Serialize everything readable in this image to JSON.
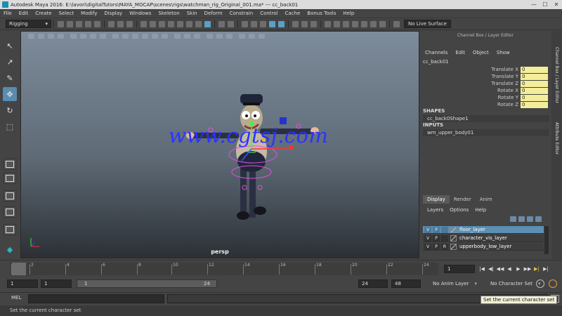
{
  "window": {
    "title": "Autodesk Maya 2016: E:\\lavori\\digitalTutors\\MAYA_MOCAP\\scenes\\rigs\\watchman_rig_Original_001.ma*   ---   cc_back01",
    "minimize": "—",
    "maximize": "☐",
    "close": "✕"
  },
  "menubar": [
    "File",
    "Edit",
    "Create",
    "Select",
    "Modify",
    "Display",
    "Windows",
    "Skeleton",
    "Skin",
    "Deform",
    "Constrain",
    "Control",
    "Cache",
    "Bonus Tools",
    "Help"
  ],
  "statusline": {
    "mode": "Rigging",
    "live_surface": "No Live Surface"
  },
  "viewport": {
    "camera_label": "persp",
    "watermark": "www.cgtsj.com"
  },
  "channel_box": {
    "header": "Channel Box / Layer Editor",
    "menu": [
      "Channels",
      "Edit",
      "Object",
      "Show"
    ],
    "node": "cc_back01",
    "attributes": [
      {
        "label": "Translate X",
        "value": "0"
      },
      {
        "label": "Translate Y",
        "value": "0"
      },
      {
        "label": "Translate Z",
        "value": "0"
      },
      {
        "label": "Rotate X",
        "value": "0"
      },
      {
        "label": "Rotate Y",
        "value": "0"
      },
      {
        "label": "Rotate Z",
        "value": "0"
      }
    ],
    "shapes_label": "SHAPES",
    "shape": "cc_back0Shape1",
    "inputs_label": "INPUTS",
    "input": "wm_upper_body01"
  },
  "side_tabs": [
    "Channel Box / Layer Editor",
    "Attribute Editor"
  ],
  "layer_editor": {
    "tabs": [
      "Display",
      "Render",
      "Anim"
    ],
    "active_tab": "Display",
    "menu": [
      "Layers",
      "Options",
      "Help"
    ],
    "layers": [
      {
        "v": "V",
        "p": "P",
        "r": "",
        "name": "floor_layer",
        "selected": true
      },
      {
        "v": "V",
        "p": "P",
        "r": "",
        "name": "character_vis_layer",
        "selected": false
      },
      {
        "v": "V",
        "p": "P",
        "r": "R",
        "name": "upperbody_low_layer",
        "selected": false
      }
    ]
  },
  "time_slider": {
    "ticks": [
      "1",
      "2",
      "4",
      "6",
      "8",
      "10",
      "12",
      "14",
      "16",
      "18",
      "20",
      "22",
      "24"
    ],
    "current_frame": "1",
    "buttons": [
      "|◀",
      "◀|",
      "◀◀",
      "◀",
      "▶",
      "▶▶",
      "▶|",
      "▶|"
    ]
  },
  "range_slider": {
    "start": "1",
    "playback_start": "1",
    "bar_start": "1",
    "bar_end": "24",
    "playback_end": "24",
    "end": "48",
    "anim_layer": "No Anim Layer",
    "character_set": "No Character Set"
  },
  "command_line": {
    "label": "MEL",
    "tooltip": "Set the current character set"
  },
  "help_line": {
    "text": "Set the current character set"
  }
}
